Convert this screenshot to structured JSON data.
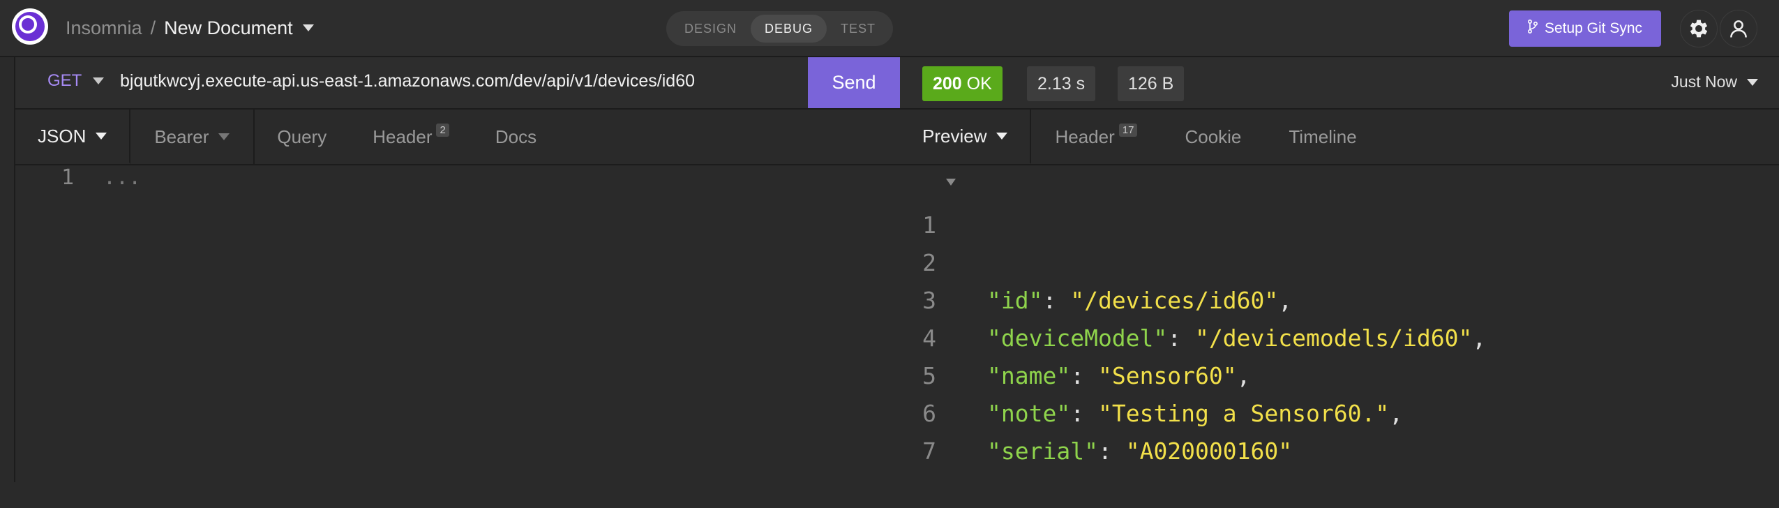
{
  "app": {
    "name": "Insomnia",
    "separator": "/",
    "document": "New Document"
  },
  "modes": [
    "DESIGN",
    "DEBUG",
    "TEST"
  ],
  "active_mode": "DEBUG",
  "git_sync_label": "Setup Git Sync",
  "request": {
    "method": "GET",
    "url": "bjqutkwcyj.execute-api.us-east-1.amazonaws.com/dev/api/v1/devices/id60",
    "send_label": "Send",
    "tabs": {
      "body": "JSON",
      "auth": "Bearer",
      "query": "Query",
      "header": "Header",
      "header_count": "2",
      "docs": "Docs"
    },
    "editor": {
      "line_number": "1",
      "placeholder": "..."
    }
  },
  "response": {
    "status_code": "200",
    "status_text": "OK",
    "time": "2.13 s",
    "size": "126 B",
    "history": "Just Now",
    "tabs": {
      "preview": "Preview",
      "header": "Header",
      "header_count": "17",
      "cookie": "Cookie",
      "timeline": "Timeline"
    },
    "lines": [
      {
        "n": "1"
      },
      {
        "n": "2",
        "key": "\"id\"",
        "value": "\"/devices/id60\"",
        "comma": ","
      },
      {
        "n": "3",
        "key": "\"deviceModel\"",
        "value": "\"/devicemodels/id60\"",
        "comma": ","
      },
      {
        "n": "4",
        "key": "\"name\"",
        "value": "\"Sensor60\"",
        "comma": ","
      },
      {
        "n": "5",
        "key": "\"note\"",
        "value": "\"Testing a Sensor60.\"",
        "comma": ","
      },
      {
        "n": "6",
        "key": "\"serial\"",
        "value": "\"A020000160\"",
        "comma": ""
      },
      {
        "n": "7"
      }
    ]
  }
}
